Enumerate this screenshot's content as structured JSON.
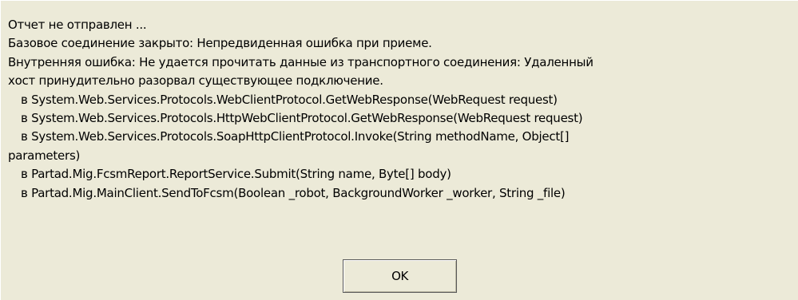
{
  "dialog": {
    "lines": [
      "Отчет не отправлен ...",
      "Базовое соединение закрыто: Непредвиденная ошибка при приеме.",
      "Внутренняя ошибка: Не удается прочитать данные из транспортного соединения: Удаленный",
      "хост принудительно разорвал существующее подключение.",
      "в System.Web.Services.Protocols.WebClientProtocol.GetWebResponse(WebRequest request)",
      "в System.Web.Services.Protocols.HttpWebClientProtocol.GetWebResponse(WebRequest request)",
      "в System.Web.Services.Protocols.SoapHttpClientProtocol.Invoke(String methodName, Object[]",
      "parameters)",
      "в Partad.Mig.FcsmReport.ReportService.Submit(String name, Byte[] body)",
      "в Partad.Mig.MainClient.SendToFcsm(Boolean _robot, BackgroundWorker _worker, String _file)"
    ],
    "ok_label": "OK"
  }
}
